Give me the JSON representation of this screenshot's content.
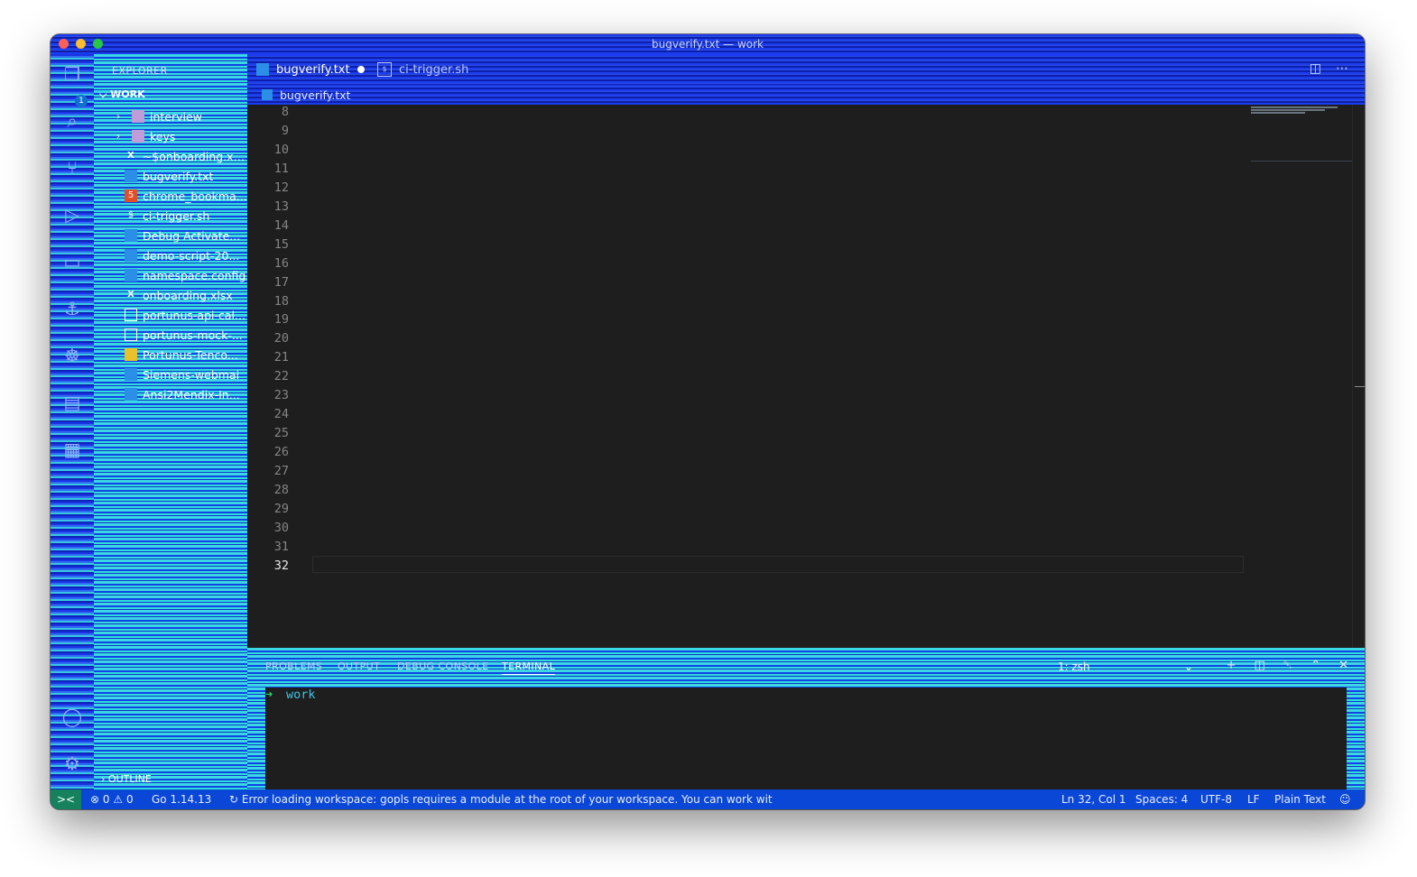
{
  "window": {
    "title": "bugverify.txt — work"
  },
  "activity_bar": {
    "explorer_badge": "1",
    "icons": [
      "files-icon",
      "search-icon",
      "source-control-icon",
      "run-debug-icon",
      "remote-explorer-icon",
      "docker-icon",
      "kubernetes-icon",
      "api-icon",
      "extensions-icon",
      "account-icon",
      "gear-icon"
    ]
  },
  "sidebar": {
    "header": "EXPLORER",
    "root": "WORK",
    "folders": [
      {
        "label": "interview",
        "icon": "folder-icon"
      },
      {
        "label": "keys",
        "icon": "folder-icon"
      }
    ],
    "files": [
      {
        "label": "~$onboarding.xlsx",
        "icon": "excel-file-icon"
      },
      {
        "label": "bugverify.txt",
        "icon": "text-file-icon"
      },
      {
        "label": "chrome_bookma...",
        "icon": "html-file-icon"
      },
      {
        "label": "ci-trigger.sh",
        "icon": "shell-file-icon"
      },
      {
        "label": "Debug Activate...",
        "icon": "text-file-icon"
      },
      {
        "label": "demo-script-20...",
        "icon": "text-file-icon"
      },
      {
        "label": "namespace.config",
        "icon": "text-file-icon"
      },
      {
        "label": "onboarding.xlsx",
        "icon": "excel-file-icon"
      },
      {
        "label": "portunus-api-cal...",
        "icon": "table-file-icon"
      },
      {
        "label": "portunus-mock-...",
        "icon": "table-file-icon"
      },
      {
        "label": "Portunus-Tenco...",
        "icon": "yellow-file-icon"
      },
      {
        "label": "Siemens-webmai",
        "icon": "text-file-icon"
      },
      {
        "label": "Ansi2Mendix-In...",
        "icon": "text-file-icon"
      }
    ],
    "outline": "OUTLINE"
  },
  "tabs": [
    {
      "label": "bugverify.txt",
      "active": true,
      "modified": true
    },
    {
      "label": "ci-trigger.sh",
      "active": false
    }
  ],
  "breadcrumb": "bugverify.txt",
  "editor": {
    "line_numbers": [
      "8",
      "9",
      "10",
      "11",
      "12",
      "13",
      "14",
      "15",
      "16",
      "17",
      "18",
      "19",
      "20",
      "21",
      "22",
      "23",
      "24",
      "25",
      "26",
      "27",
      "28",
      "29",
      "30",
      "31",
      "32"
    ],
    "active_line": "32"
  },
  "panel": {
    "tabs": [
      "PROBLEMS",
      "OUTPUT",
      "DEBUG CONSOLE",
      "TERMINAL"
    ],
    "active_tab": "TERMINAL",
    "terminal_select": "1: zsh",
    "terminal": {
      "prompt": "➜",
      "cwd": "work"
    }
  },
  "status_bar": {
    "remote": "><",
    "errors": "0",
    "warnings": "0",
    "go_version": "Go 1.14.13",
    "message": "Error loading workspace: gopls requires a module at the root of your workspace. You can work wit",
    "position": "Ln 32, Col 1",
    "spaces": "Spaces: 4",
    "encoding": "UTF-8",
    "eol": "LF",
    "language": "Plain Text"
  }
}
